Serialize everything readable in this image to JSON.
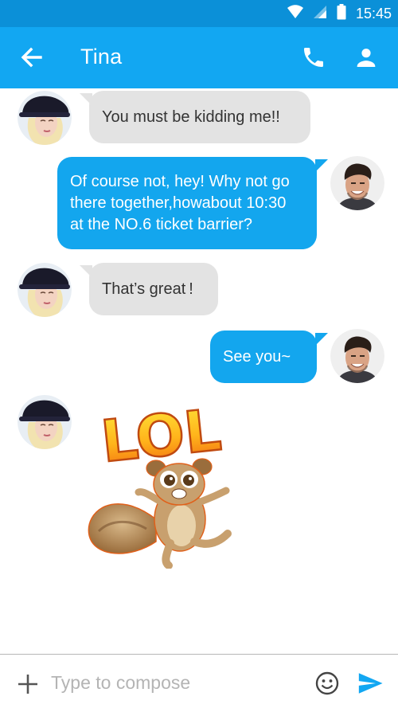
{
  "status_bar": {
    "time": "15:45",
    "icons": [
      "wifi-icon",
      "cellular-signal-icon",
      "battery-icon"
    ],
    "color": "#0b90d8"
  },
  "app_bar": {
    "title": "Tina",
    "back_icon": "arrow-left-icon",
    "call_icon": "phone-icon",
    "contact_icon": "person-icon",
    "color": "#12a7f2"
  },
  "messages": [
    {
      "direction": "incoming",
      "sender": "Tina",
      "text": "You must be kidding me!!"
    },
    {
      "direction": "outgoing",
      "sender": "me",
      "lines": [
        "Of course not, hey! Why not go",
        "there together,howabout 10:30",
        "at the NO.6 ticket barrier?"
      ]
    },
    {
      "direction": "incoming",
      "sender": "Tina",
      "text": "That’s great !"
    },
    {
      "direction": "outgoing",
      "sender": "me",
      "text": "See you~"
    },
    {
      "direction": "incoming",
      "sender": "Tina",
      "sticker": {
        "caption": "LOL",
        "image": "lemur-sticker"
      }
    }
  ],
  "compose": {
    "placeholder": "Type to compose",
    "value": "",
    "add_icon": "plus-icon",
    "emoji_icon": "smiley-icon",
    "send_icon": "send-icon"
  },
  "colors": {
    "incoming_bubble": "#e3e3e3",
    "outgoing_bubble": "#13a6ee",
    "send_icon": "#12a7f2"
  }
}
